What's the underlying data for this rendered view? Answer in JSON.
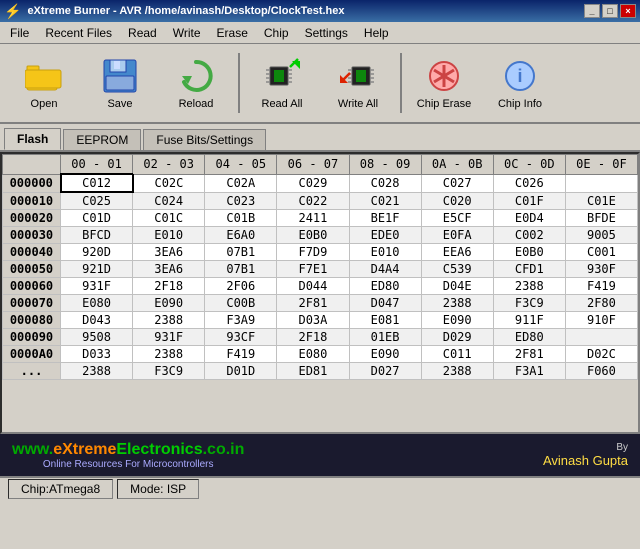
{
  "window": {
    "title": "eXtreme Burner - AVR /home/avinash/Desktop/ClockTest.hex",
    "controls": [
      "_",
      "□",
      "×"
    ]
  },
  "menubar": {
    "items": [
      "File",
      "Recent Files",
      "Read",
      "Write",
      "Erase",
      "Chip",
      "Settings",
      "Help"
    ]
  },
  "toolbar": {
    "buttons": [
      {
        "label": "Open",
        "icon": "folder"
      },
      {
        "label": "Save",
        "icon": "save"
      },
      {
        "label": "Reload",
        "icon": "reload"
      },
      {
        "label": "Read All",
        "icon": "read-all"
      },
      {
        "label": "Write All",
        "icon": "write-all"
      },
      {
        "label": "Chip Erase",
        "icon": "chip-erase"
      },
      {
        "label": "Chip Info",
        "icon": "chip-info"
      }
    ]
  },
  "tabs": [
    {
      "label": "Flash",
      "active": true
    },
    {
      "label": "EEPROM",
      "active": false
    },
    {
      "label": "Fuse Bits/Settings",
      "active": false
    }
  ],
  "table": {
    "headers": [
      "00 - 01",
      "02 - 03",
      "04 - 05",
      "06 - 07",
      "08 - 09",
      "0A - 0B",
      "0C - 0D",
      "0E - 0F"
    ],
    "rows": [
      {
        "addr": "000000",
        "cells": [
          "C012",
          "C02C",
          "C02A",
          "C029",
          "C028",
          "C027",
          "C026",
          ""
        ],
        "highlight": 0
      },
      {
        "addr": "000010",
        "cells": [
          "C025",
          "C024",
          "C023",
          "C022",
          "C021",
          "C020",
          "C01F",
          "C01E"
        ]
      },
      {
        "addr": "000020",
        "cells": [
          "C01D",
          "C01C",
          "C01B",
          "2411",
          "BE1F",
          "E5CF",
          "E0D4",
          "BFDE"
        ]
      },
      {
        "addr": "000030",
        "cells": [
          "BFCD",
          "E010",
          "E6A0",
          "E0B0",
          "EDE0",
          "E0FA",
          "C002",
          "9005"
        ]
      },
      {
        "addr": "000040",
        "cells": [
          "920D",
          "3EA6",
          "07B1",
          "F7D9",
          "E010",
          "EEA6",
          "E0B0",
          "C001"
        ]
      },
      {
        "addr": "000050",
        "cells": [
          "921D",
          "3EA6",
          "07B1",
          "F7E1",
          "D4A4",
          "C539",
          "CFD1",
          "930F"
        ]
      },
      {
        "addr": "000060",
        "cells": [
          "931F",
          "2F18",
          "2F06",
          "D044",
          "ED80",
          "D04E",
          "2388",
          "F419"
        ]
      },
      {
        "addr": "000070",
        "cells": [
          "E080",
          "E090",
          "C00B",
          "2F81",
          "D047",
          "2388",
          "F3C9",
          "2F80"
        ]
      },
      {
        "addr": "000080",
        "cells": [
          "D043",
          "2388",
          "F3A9",
          "D03A",
          "E081",
          "E090",
          "911F",
          "910F"
        ]
      },
      {
        "addr": "000090",
        "cells": [
          "9508",
          "931F",
          "93CF",
          "2F18",
          "01EB",
          "D029",
          "ED80",
          ""
        ]
      },
      {
        "addr": "0000A0",
        "cells": [
          "D033",
          "2388",
          "F419",
          "E080",
          "E090",
          "C011",
          "2F81",
          "D02C"
        ]
      },
      {
        "addr": "...",
        "cells": [
          "2388",
          "F3C9",
          "D01D",
          "ED81",
          "D027",
          "2388",
          "F3A1",
          "F060"
        ]
      }
    ]
  },
  "footer": {
    "url_prefix": "www.",
    "url_brand": "eXtreme",
    "url_domain": "Electronics",
    "url_suffix": ".co.in",
    "url_full": "www.eXtremeElectronics.co.in",
    "tagline": "Online Resources For Microcontrollers",
    "by_label": "By",
    "author": "Avinash Gupta"
  },
  "statusbar": {
    "chip_label": "Chip:ATmega8",
    "mode_label": "Mode: ISP"
  }
}
